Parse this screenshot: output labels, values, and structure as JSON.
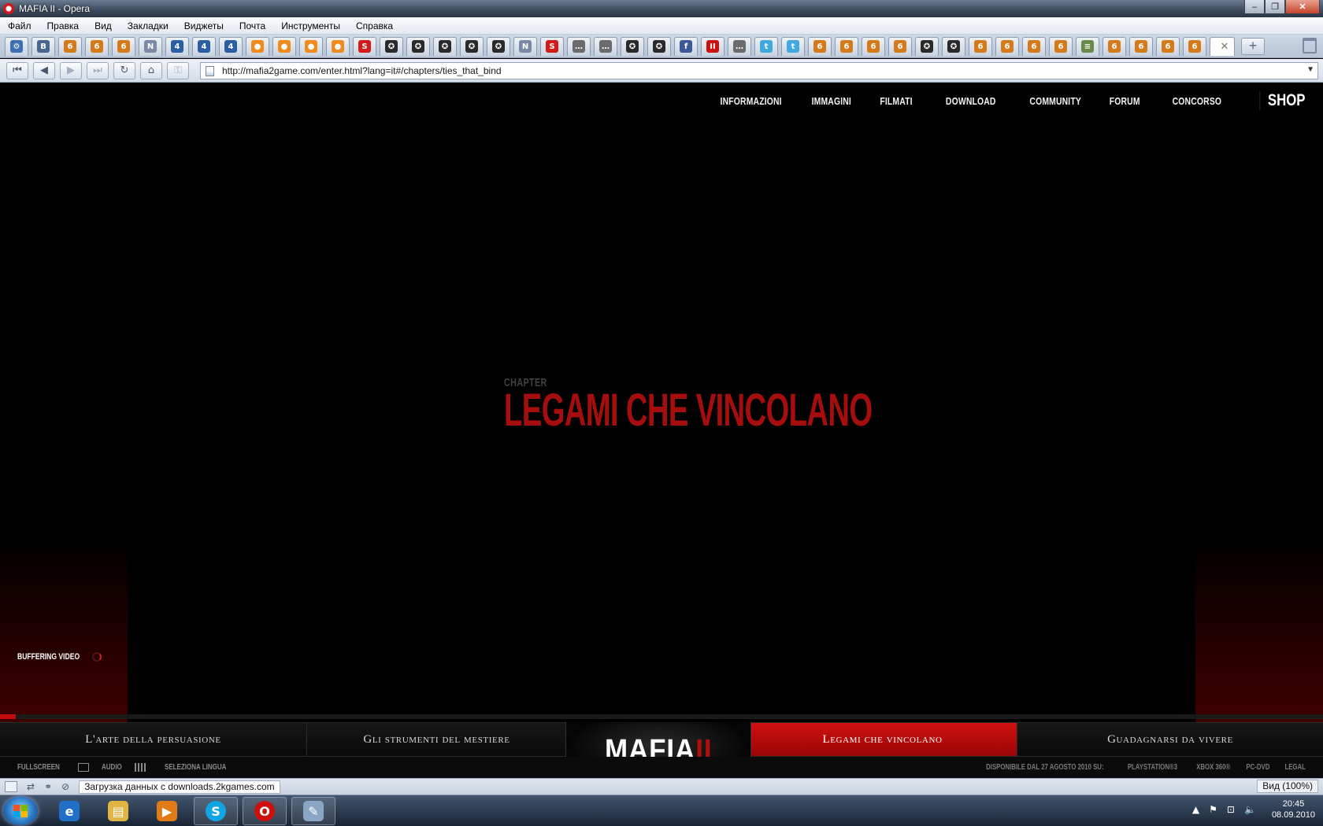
{
  "window": {
    "title": "MAFIA II - Opera"
  },
  "menubar": [
    "Файл",
    "Правка",
    "Вид",
    "Закладки",
    "Виджеты",
    "Почта",
    "Инструменты",
    "Справка"
  ],
  "tabs": [
    {
      "icon": "gear-icon",
      "color": "#3d6fb3",
      "glyph": "⚙"
    },
    {
      "icon": "vk-icon",
      "color": "#45668e",
      "glyph": "B"
    },
    {
      "icon": "site-icon",
      "color": "#d47a1a",
      "glyph": "6"
    },
    {
      "icon": "site-icon",
      "color": "#d47a1a",
      "glyph": "6"
    },
    {
      "icon": "site-icon",
      "color": "#d47a1a",
      "glyph": "6"
    },
    {
      "icon": "n-icon",
      "color": "#7a8aa6",
      "glyph": "N"
    },
    {
      "icon": "four-icon",
      "color": "#2a5fa5",
      "glyph": "4"
    },
    {
      "icon": "four-icon",
      "color": "#2a5fa5",
      "glyph": "4"
    },
    {
      "icon": "four-icon",
      "color": "#2a5fa5",
      "glyph": "4"
    },
    {
      "icon": "orange-icon",
      "color": "#f08a1a",
      "glyph": "●"
    },
    {
      "icon": "orange-icon",
      "color": "#f08a1a",
      "glyph": "●"
    },
    {
      "icon": "orange-icon",
      "color": "#f08a1a",
      "glyph": "●"
    },
    {
      "icon": "orange-icon",
      "color": "#f08a1a",
      "glyph": "●"
    },
    {
      "icon": "s-icon",
      "color": "#d21a1a",
      "glyph": "S"
    },
    {
      "icon": "badge-icon",
      "color": "#2a2a2a",
      "glyph": "✪"
    },
    {
      "icon": "badge-icon",
      "color": "#2a2a2a",
      "glyph": "✪"
    },
    {
      "icon": "badge-icon",
      "color": "#2a2a2a",
      "glyph": "✪"
    },
    {
      "icon": "badge-icon",
      "color": "#2a2a2a",
      "glyph": "✪"
    },
    {
      "icon": "badge-icon",
      "color": "#2a2a2a",
      "glyph": "✪"
    },
    {
      "icon": "n-icon",
      "color": "#7a8aa6",
      "glyph": "N"
    },
    {
      "icon": "s-icon",
      "color": "#d21a1a",
      "glyph": "S"
    },
    {
      "icon": "dots-icon",
      "color": "#6b6b6b",
      "glyph": "…"
    },
    {
      "icon": "dots-icon",
      "color": "#6b6b6b",
      "glyph": "…"
    },
    {
      "icon": "badge-icon",
      "color": "#2a2a2a",
      "glyph": "✪"
    },
    {
      "icon": "badge-icon",
      "color": "#2a2a2a",
      "glyph": "✪"
    },
    {
      "icon": "facebook-icon",
      "color": "#3b5998",
      "glyph": "f"
    },
    {
      "icon": "ii-icon",
      "color": "#c11",
      "glyph": "II"
    },
    {
      "icon": "dots-icon",
      "color": "#6b6b6b",
      "glyph": "…"
    },
    {
      "icon": "twitter-icon",
      "color": "#3fa9e0",
      "glyph": "t"
    },
    {
      "icon": "twitter-icon",
      "color": "#3fa9e0",
      "glyph": "t"
    },
    {
      "icon": "site-icon",
      "color": "#d47a1a",
      "glyph": "6"
    },
    {
      "icon": "site-icon",
      "color": "#d47a1a",
      "glyph": "6"
    },
    {
      "icon": "site-icon",
      "color": "#d47a1a",
      "glyph": "6"
    },
    {
      "icon": "site-icon",
      "color": "#d47a1a",
      "glyph": "6"
    },
    {
      "icon": "badge-icon",
      "color": "#2a2a2a",
      "glyph": "✪"
    },
    {
      "icon": "badge-icon",
      "color": "#2a2a2a",
      "glyph": "✪"
    },
    {
      "icon": "site-icon",
      "color": "#d47a1a",
      "glyph": "6"
    },
    {
      "icon": "site-icon",
      "color": "#d47a1a",
      "glyph": "6"
    },
    {
      "icon": "site-icon",
      "color": "#d47a1a",
      "glyph": "6"
    },
    {
      "icon": "site-icon",
      "color": "#d47a1a",
      "glyph": "6"
    },
    {
      "icon": "doc-icon",
      "color": "#6a8a4a",
      "glyph": "≡"
    },
    {
      "icon": "site-icon",
      "color": "#d47a1a",
      "glyph": "6"
    },
    {
      "icon": "site-icon",
      "color": "#d47a1a",
      "glyph": "6"
    },
    {
      "icon": "site-icon",
      "color": "#d47a1a",
      "glyph": "6"
    },
    {
      "icon": "site-icon",
      "color": "#d47a1a",
      "glyph": "6"
    }
  ],
  "address": {
    "url": "http://mafia2game.com/enter.html?lang=it#/chapters/ties_that_bind"
  },
  "site": {
    "nav": [
      "INFORMAZIONI",
      "IMMAGINI",
      "FILMATI",
      "DOWNLOAD",
      "COMMUNITY",
      "FORUM",
      "CONCORSO"
    ],
    "shop": "SHOP",
    "chapter_label": "CHAPTER",
    "chapter_title": "LEGAMI CHE VINCOLANO",
    "buffering": "BUFFERING VIDEO",
    "progress": 0.012,
    "chapters": [
      "L'arte della persuasione",
      "Gli strumenti del mestiere",
      "Legami che vincolano",
      "Guadagnarsi da vivere"
    ],
    "active_chapter": 2,
    "logo": {
      "main": "MAFIA",
      "numeral": "II"
    },
    "bottom_left": {
      "fullscreen": "FULLSCREEN",
      "audio": "AUDIO",
      "language": "SELEZIONA LINGUA"
    },
    "bottom_right": [
      "DISPONIBILE DAL 27 AGOSTO 2010 SU:",
      "PLAYSTATION®3",
      "XBOX 360®",
      "PC-DVD",
      "LEGAL"
    ],
    "accent": "#c30c0c"
  },
  "statusbar": {
    "text": "Загрузка данных с downloads.2kgames.com",
    "zoom": "Вид (100%)"
  },
  "taskbar": {
    "time": "20:45",
    "date": "08.09.2010"
  }
}
